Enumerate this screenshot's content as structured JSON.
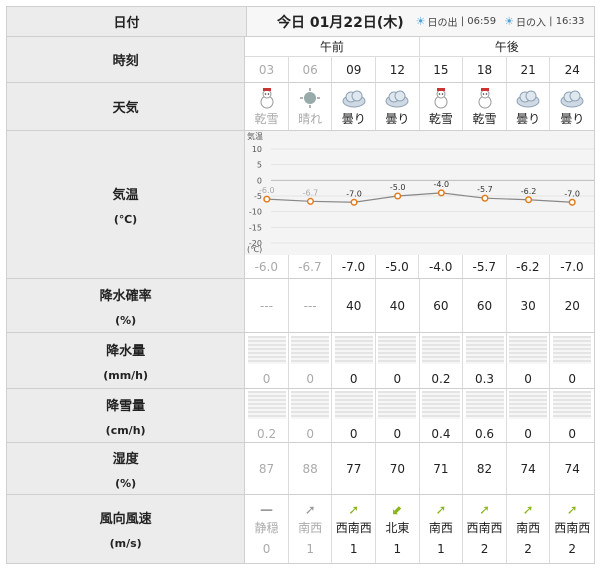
{
  "labels": {
    "date": "日付",
    "time": "時刻",
    "weather": "天気",
    "temp": "気温",
    "temp_unit": "(℃)",
    "precip_prob": "降水確率",
    "precip_prob_unit": "(%)",
    "precip": "降水量",
    "precip_unit": "(mm/h)",
    "snow": "降雪量",
    "snow_unit": "(cm/h)",
    "humidity": "湿度",
    "humidity_unit": "(%)",
    "wind": "風向風速",
    "wind_unit": "(m/s)"
  },
  "header": {
    "date": "今日 01月22日(木)",
    "sunrise_label": "日の出",
    "sunrise": "06:59",
    "sunset_label": "日の入",
    "sunset": "16:33",
    "am": "午前",
    "pm": "午後"
  },
  "hours": [
    "03",
    "06",
    "09",
    "12",
    "15",
    "18",
    "21",
    "24"
  ],
  "weather": [
    "乾雪",
    "晴れ",
    "曇り",
    "曇り",
    "乾雪",
    "乾雪",
    "曇り",
    "曇り"
  ],
  "weather_icons": [
    "snowman-icon",
    "sun-icon",
    "cloud-icon",
    "cloud-icon",
    "snowman-icon",
    "snowman-icon",
    "cloud-icon",
    "cloud-icon"
  ],
  "temps": [
    "-6.0",
    "-6.7",
    "-7.0",
    "-5.0",
    "-4.0",
    "-5.7",
    "-6.2",
    "-7.0"
  ],
  "precip_prob": [
    "---",
    "---",
    "40",
    "40",
    "60",
    "60",
    "30",
    "20"
  ],
  "precip": [
    "0",
    "0",
    "0",
    "0",
    "0.2",
    "0.3",
    "0",
    "0"
  ],
  "snow": [
    "0.2",
    "0",
    "0",
    "0",
    "0.4",
    "0.6",
    "0",
    "0"
  ],
  "humidity": [
    "87",
    "88",
    "77",
    "70",
    "71",
    "82",
    "74",
    "74"
  ],
  "wind_dir": [
    "静穏",
    "南西",
    "西南西",
    "北東",
    "南西",
    "西南西",
    "南西",
    "西南西"
  ],
  "wind_icons": [
    "calm-icon",
    "arrow-southwest-icon",
    "arrow-wsw-icon",
    "arrow-northeast-icon",
    "arrow-southwest-icon",
    "arrow-wsw-icon",
    "arrow-southwest-icon",
    "arrow-wsw-icon"
  ],
  "wind_speed": [
    "0",
    "1",
    "1",
    "1",
    "1",
    "2",
    "2",
    "2"
  ],
  "chart_data": {
    "type": "line",
    "ylabel": "気温",
    "yunit": "(℃)",
    "ylim": [
      -20,
      10
    ],
    "yticks": [
      "10",
      "5",
      "0",
      "-5",
      "-10",
      "-15",
      "-20"
    ],
    "x": [
      "03",
      "06",
      "09",
      "12",
      "15",
      "18",
      "21",
      "24"
    ],
    "values": [
      -6.0,
      -6.7,
      -7.0,
      -5.0,
      -4.0,
      -5.7,
      -6.2,
      -7.0
    ],
    "labels": [
      "-6.0",
      "-6.7",
      "-7.0",
      "-5.0",
      "-4.0",
      "-5.7",
      "-6.2",
      "-7.0"
    ],
    "colors": {
      "line": "#888888",
      "marker": "#e07b1a",
      "past": "#aaaaaa"
    }
  },
  "past_count": 2
}
